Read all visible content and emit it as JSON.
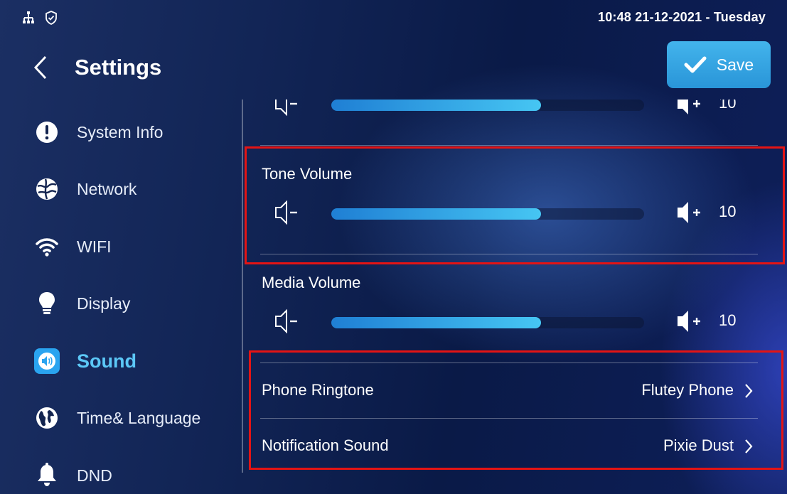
{
  "status_bar": {
    "icons": [
      "network-tree-icon",
      "shield-check-icon"
    ],
    "datetime": "10:48  21-12-2021 - Tuesday"
  },
  "header": {
    "title": "Settings",
    "save_label": "Save"
  },
  "sidebar": {
    "items": [
      {
        "label": "System Info",
        "icon": "exclamation-circle-icon",
        "active": false
      },
      {
        "label": "Network",
        "icon": "globe-network-icon",
        "active": false
      },
      {
        "label": "WIFI",
        "icon": "wifi-icon",
        "active": false
      },
      {
        "label": "Display",
        "icon": "lightbulb-icon",
        "active": false
      },
      {
        "label": "Sound",
        "icon": "speaker-icon",
        "active": true
      },
      {
        "label": "Time& Language",
        "icon": "globe-icon",
        "active": false
      },
      {
        "label": "DND",
        "icon": "bell-icon",
        "active": false
      }
    ]
  },
  "content": {
    "partial_volume": {
      "value": "10",
      "level_fraction": 0.67
    },
    "tone_volume": {
      "label": "Tone Volume",
      "value": "10",
      "level_fraction": 0.67
    },
    "media_volume": {
      "label": "Media Volume",
      "value": "10",
      "level_fraction": 0.67
    },
    "phone_ringtone": {
      "label": "Phone Ringtone",
      "value": "Flutey Phone"
    },
    "notification_sound": {
      "label": "Notification Sound",
      "value": "Pixie Dust"
    }
  },
  "colors": {
    "accent": "#2aa4f0",
    "active_text": "#5cc8f7",
    "highlight_box": "#e41414"
  }
}
